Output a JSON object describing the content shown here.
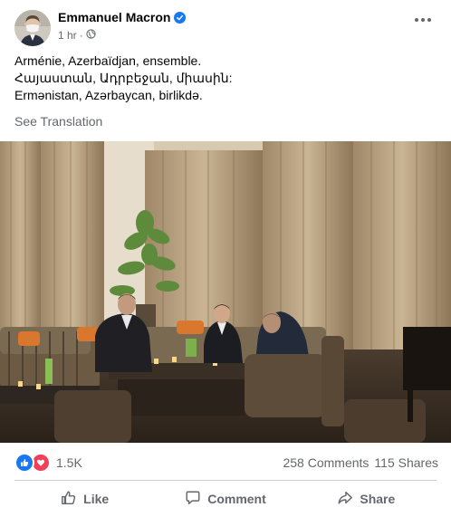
{
  "post": {
    "author": "Emmanuel Macron",
    "time": "1 hr",
    "lines": [
      "Arménie, Azerbaïdjan, ensemble.",
      "Հայաստան, Ադրբեջան, միասին:",
      "Ermənistan, Azərbaycan, birlikdə."
    ],
    "see_translation": "See Translation"
  },
  "stats": {
    "reactions": "1.5K",
    "comments": "258 Comments",
    "shares": "115 Shares"
  },
  "actions": {
    "like": "Like",
    "comment": "Comment",
    "share": "Share"
  },
  "colors": {
    "brand_blue": "#1877f2",
    "love_red": "#f33e58",
    "secondary_text": "#65676b"
  },
  "icons": [
    "verified-badge-icon",
    "globe-icon",
    "more-options-icon",
    "like-reaction-icon",
    "love-reaction-icon",
    "thumbs-up-icon",
    "comment-icon",
    "share-arrow-icon"
  ]
}
